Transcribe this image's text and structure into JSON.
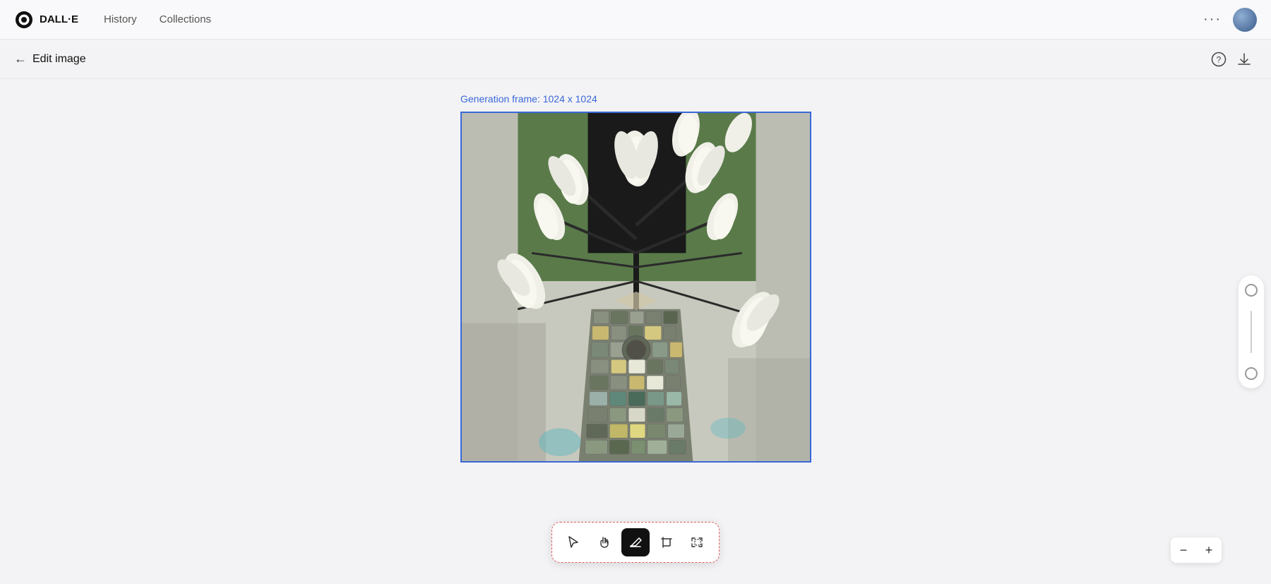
{
  "app": {
    "logo_text": "DALL·E",
    "nav": {
      "history_label": "History",
      "collections_label": "Collections",
      "more_icon": "···"
    }
  },
  "toolbar": {
    "back_label": "Edit image",
    "help_icon": "?",
    "download_icon": "↓"
  },
  "canvas": {
    "generation_frame_label": "Generation frame: 1024 x 1024"
  },
  "tools": {
    "select_label": "Select",
    "hand_label": "Hand/Pan",
    "eraser_label": "Eraser",
    "crop_label": "Crop",
    "expand_label": "Expand"
  },
  "zoom": {
    "minus_label": "−",
    "plus_label": "+"
  },
  "slider": {
    "label": "Brush size"
  }
}
